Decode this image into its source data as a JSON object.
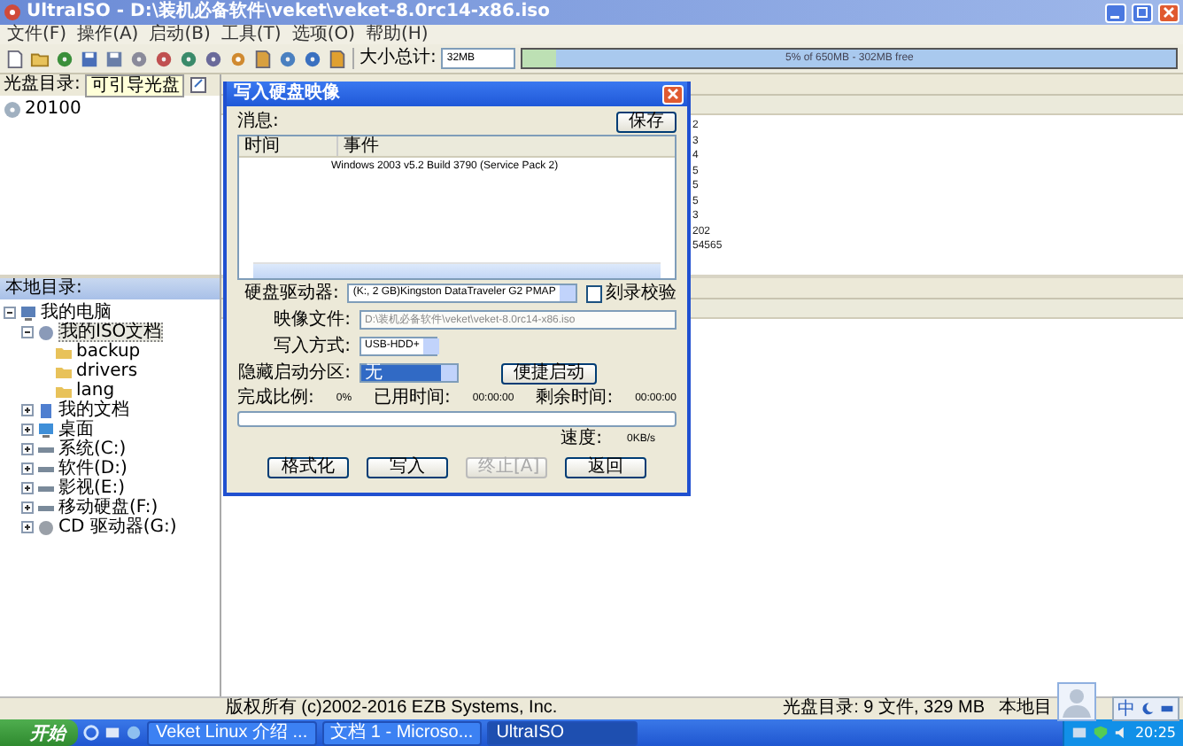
{
  "window": {
    "title": "UltraISO - D:\\装机必备软件\\veket\\veket-8.0rc14-x86.iso"
  },
  "menu": [
    "文件(F)",
    "操作(A)",
    "启动(B)",
    "工具(T)",
    "选项(O)",
    "帮助(H)"
  ],
  "toolbar": {
    "size_label": "大小总计:",
    "size_value": "32MB",
    "capacity": {
      "level": 0.05,
      "reading": "5% of 650MB - 302MB free"
    }
  },
  "image_pane": {
    "label": "光盘目录:",
    "boot_type": "可引导光盘",
    "tree": [
      {
        "label": "20100",
        "kind": "disc"
      }
    ]
  },
  "file_list": {
    "values": [
      "2",
      "3",
      "4",
      "5",
      "5",
      "5",
      "3",
      "202",
      "54565"
    ]
  },
  "local_pane": {
    "label": "本地目录:",
    "tree": [
      {
        "label": "我的电脑",
        "kind": "computer",
        "expanded": true,
        "selected": false,
        "children": [
          {
            "label": "我的ISO文档",
            "kind": "iso",
            "expanded": true,
            "selected": true,
            "children": [
              {
                "label": "backup",
                "kind": "folder",
                "selected": false
              },
              {
                "label": "drivers",
                "kind": "folder",
                "selected": false
              },
              {
                "label": "lang",
                "kind": "folder",
                "selected": false
              }
            ]
          },
          {
            "label": "我的文档",
            "kind": "documents",
            "expanded": false,
            "selected": false
          },
          {
            "label": "桌面",
            "kind": "desktop",
            "expanded": false,
            "selected": false
          },
          {
            "label": "系统(C:)",
            "kind": "drive",
            "expanded": false,
            "selected": false
          },
          {
            "label": "软件(D:)",
            "kind": "drive",
            "expanded": false,
            "selected": false
          },
          {
            "label": "影视(E:)",
            "kind": "drive",
            "expanded": false,
            "selected": false
          },
          {
            "label": "移动硬盘(F:)",
            "kind": "drive",
            "expanded": false,
            "selected": false
          },
          {
            "label": "CD 驱动器(G:)",
            "kind": "cdrom",
            "expanded": false,
            "selected": false
          }
        ]
      }
    ]
  },
  "dialog": {
    "title": "写入硬盘映像",
    "message_label": "消息:",
    "save_button": "保存",
    "log_columns": [
      "时间",
      "事件"
    ],
    "log_rows": [
      {
        "time": "",
        "event": "Windows 2003 v5.2 Build 3790 (Service Pack 2)"
      }
    ],
    "drive_label": "硬盘驱动器:",
    "drive_value": "(K:, 2 GB)Kingston DataTraveler G2 PMAP",
    "verify": {
      "label": "刻录校验",
      "checked": false
    },
    "image_label": "映像文件:",
    "image_value": "D:\\装机必备软件\\veket\\veket-8.0rc14-x86.iso",
    "mode_label": "写入方式:",
    "mode_value": "USB-HDD+",
    "hidden_label": "隐藏启动分区:",
    "hidden_value": "无",
    "quick_boot_button": "便捷启动",
    "progress_label": "完成比例:",
    "progress_value": "0%",
    "elapsed_label": "已用时间:",
    "elapsed_value": "00:00:00",
    "remaining_label": "剩余时间:",
    "remaining_value": "00:00:00",
    "progress": {
      "level": 0
    },
    "speed_label": "速度:",
    "speed_value": "0KB/s",
    "buttons": [
      {
        "label": "格式化",
        "disabled": false
      },
      {
        "label": "写入",
        "disabled": false
      },
      {
        "label": "终止[A]",
        "disabled": true
      },
      {
        "label": "返回",
        "disabled": false
      }
    ]
  },
  "status_bar": [
    "版权所有 (c)2002-2016 EZB Systems, Inc.",
    "光盘目录: 9 文件, 329 MB",
    "本地目"
  ],
  "taskbar": {
    "start": "开始",
    "tasks": [
      {
        "label": "Veket Linux 介绍 ...",
        "selected": false
      },
      {
        "label": "文档 1 - Microso...",
        "selected": false
      },
      {
        "label": "UltraISO",
        "selected": true
      }
    ],
    "ime": "中",
    "clock": "20:25"
  }
}
